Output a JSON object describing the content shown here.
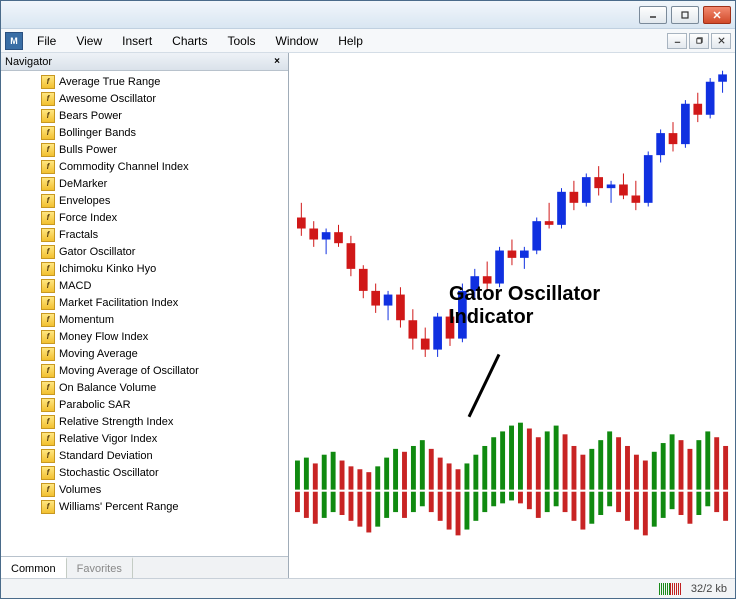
{
  "menu": {
    "items": [
      "File",
      "View",
      "Insert",
      "Charts",
      "Tools",
      "Window",
      "Help"
    ]
  },
  "navigator": {
    "title": "Navigator",
    "tabs": [
      "Common",
      "Favorites"
    ],
    "active_tab": 0,
    "indicators": [
      "Average True Range",
      "Awesome Oscillator",
      "Bears Power",
      "Bollinger Bands",
      "Bulls Power",
      "Commodity Channel Index",
      "DeMarker",
      "Envelopes",
      "Force Index",
      "Fractals",
      "Gator Oscillator",
      "Ichimoku Kinko Hyo",
      "MACD",
      "Market Facilitation Index",
      "Momentum",
      "Money Flow Index",
      "Moving Average",
      "Moving Average of Oscillator",
      "On Balance Volume",
      "Parabolic SAR",
      "Relative Strength Index",
      "Relative Vigor Index",
      "Standard Deviation",
      "Stochastic Oscillator",
      "Volumes",
      "Williams' Percent Range"
    ]
  },
  "annotation": {
    "line1": "Gator Oscillator",
    "line2": "Indicator"
  },
  "status": {
    "conn": "32/2 kb"
  },
  "colors": {
    "bull": "#1030e0",
    "bear": "#d01818",
    "gator_green": "#108a10",
    "gator_red": "#c82424"
  },
  "chart_data": {
    "type": "candlestick+oscillator",
    "candles_note": "o/h/l/c estimated from pixels, relative price units",
    "candles": [
      {
        "o": 58,
        "h": 62,
        "l": 53,
        "c": 55,
        "dir": "bear"
      },
      {
        "o": 55,
        "h": 57,
        "l": 50,
        "c": 52,
        "dir": "bear"
      },
      {
        "o": 52,
        "h": 55,
        "l": 48,
        "c": 54,
        "dir": "bull"
      },
      {
        "o": 54,
        "h": 56,
        "l": 50,
        "c": 51,
        "dir": "bear"
      },
      {
        "o": 51,
        "h": 53,
        "l": 42,
        "c": 44,
        "dir": "bear"
      },
      {
        "o": 44,
        "h": 45,
        "l": 36,
        "c": 38,
        "dir": "bear"
      },
      {
        "o": 38,
        "h": 40,
        "l": 32,
        "c": 34,
        "dir": "bear"
      },
      {
        "o": 34,
        "h": 38,
        "l": 30,
        "c": 37,
        "dir": "bull"
      },
      {
        "o": 37,
        "h": 39,
        "l": 28,
        "c": 30,
        "dir": "bear"
      },
      {
        "o": 30,
        "h": 33,
        "l": 22,
        "c": 25,
        "dir": "bear"
      },
      {
        "o": 25,
        "h": 28,
        "l": 20,
        "c": 22,
        "dir": "bear"
      },
      {
        "o": 22,
        "h": 32,
        "l": 20,
        "c": 31,
        "dir": "bull"
      },
      {
        "o": 31,
        "h": 33,
        "l": 23,
        "c": 25,
        "dir": "bear"
      },
      {
        "o": 25,
        "h": 40,
        "l": 24,
        "c": 38,
        "dir": "bull"
      },
      {
        "o": 38,
        "h": 44,
        "l": 36,
        "c": 42,
        "dir": "bull"
      },
      {
        "o": 42,
        "h": 46,
        "l": 38,
        "c": 40,
        "dir": "bear"
      },
      {
        "o": 40,
        "h": 50,
        "l": 39,
        "c": 49,
        "dir": "bull"
      },
      {
        "o": 49,
        "h": 52,
        "l": 45,
        "c": 47,
        "dir": "bear"
      },
      {
        "o": 47,
        "h": 50,
        "l": 44,
        "c": 49,
        "dir": "bull"
      },
      {
        "o": 49,
        "h": 58,
        "l": 48,
        "c": 57,
        "dir": "bull"
      },
      {
        "o": 57,
        "h": 62,
        "l": 55,
        "c": 56,
        "dir": "bear"
      },
      {
        "o": 56,
        "h": 66,
        "l": 55,
        "c": 65,
        "dir": "bull"
      },
      {
        "o": 65,
        "h": 68,
        "l": 60,
        "c": 62,
        "dir": "bear"
      },
      {
        "o": 62,
        "h": 70,
        "l": 61,
        "c": 69,
        "dir": "bull"
      },
      {
        "o": 69,
        "h": 72,
        "l": 64,
        "c": 66,
        "dir": "bear"
      },
      {
        "o": 66,
        "h": 68,
        "l": 62,
        "c": 67,
        "dir": "bull"
      },
      {
        "o": 67,
        "h": 70,
        "l": 63,
        "c": 64,
        "dir": "bear"
      },
      {
        "o": 64,
        "h": 68,
        "l": 60,
        "c": 62,
        "dir": "bear"
      },
      {
        "o": 62,
        "h": 76,
        "l": 61,
        "c": 75,
        "dir": "bull"
      },
      {
        "o": 75,
        "h": 82,
        "l": 73,
        "c": 81,
        "dir": "bull"
      },
      {
        "o": 81,
        "h": 84,
        "l": 76,
        "c": 78,
        "dir": "bear"
      },
      {
        "o": 78,
        "h": 90,
        "l": 77,
        "c": 89,
        "dir": "bull"
      },
      {
        "o": 89,
        "h": 92,
        "l": 84,
        "c": 86,
        "dir": "bear"
      },
      {
        "o": 86,
        "h": 96,
        "l": 85,
        "c": 95,
        "dir": "bull"
      },
      {
        "o": 95,
        "h": 98,
        "l": 92,
        "c": 97,
        "dir": "bull"
      }
    ],
    "gator": {
      "note": "upper & lower histogram values (relative units) and color",
      "upper": [
        {
          "v": 20,
          "c": "g"
        },
        {
          "v": 22,
          "c": "g"
        },
        {
          "v": 18,
          "c": "r"
        },
        {
          "v": 24,
          "c": "g"
        },
        {
          "v": 26,
          "c": "g"
        },
        {
          "v": 20,
          "c": "r"
        },
        {
          "v": 16,
          "c": "r"
        },
        {
          "v": 14,
          "c": "r"
        },
        {
          "v": 12,
          "c": "r"
        },
        {
          "v": 16,
          "c": "g"
        },
        {
          "v": 22,
          "c": "g"
        },
        {
          "v": 28,
          "c": "g"
        },
        {
          "v": 26,
          "c": "r"
        },
        {
          "v": 30,
          "c": "g"
        },
        {
          "v": 34,
          "c": "g"
        },
        {
          "v": 28,
          "c": "r"
        },
        {
          "v": 22,
          "c": "r"
        },
        {
          "v": 18,
          "c": "r"
        },
        {
          "v": 14,
          "c": "r"
        },
        {
          "v": 18,
          "c": "g"
        },
        {
          "v": 24,
          "c": "g"
        },
        {
          "v": 30,
          "c": "g"
        },
        {
          "v": 36,
          "c": "g"
        },
        {
          "v": 40,
          "c": "g"
        },
        {
          "v": 44,
          "c": "g"
        },
        {
          "v": 46,
          "c": "g"
        },
        {
          "v": 42,
          "c": "r"
        },
        {
          "v": 36,
          "c": "r"
        },
        {
          "v": 40,
          "c": "g"
        },
        {
          "v": 44,
          "c": "g"
        },
        {
          "v": 38,
          "c": "r"
        },
        {
          "v": 30,
          "c": "r"
        },
        {
          "v": 24,
          "c": "r"
        },
        {
          "v": 28,
          "c": "g"
        },
        {
          "v": 34,
          "c": "g"
        },
        {
          "v": 40,
          "c": "g"
        },
        {
          "v": 36,
          "c": "r"
        },
        {
          "v": 30,
          "c": "r"
        },
        {
          "v": 24,
          "c": "r"
        },
        {
          "v": 20,
          "c": "r"
        },
        {
          "v": 26,
          "c": "g"
        },
        {
          "v": 32,
          "c": "g"
        },
        {
          "v": 38,
          "c": "g"
        },
        {
          "v": 34,
          "c": "r"
        },
        {
          "v": 28,
          "c": "r"
        },
        {
          "v": 34,
          "c": "g"
        },
        {
          "v": 40,
          "c": "g"
        },
        {
          "v": 36,
          "c": "r"
        },
        {
          "v": 30,
          "c": "r"
        }
      ],
      "lower": [
        {
          "v": 14,
          "c": "r"
        },
        {
          "v": 18,
          "c": "r"
        },
        {
          "v": 22,
          "c": "r"
        },
        {
          "v": 18,
          "c": "g"
        },
        {
          "v": 14,
          "c": "g"
        },
        {
          "v": 16,
          "c": "r"
        },
        {
          "v": 20,
          "c": "r"
        },
        {
          "v": 24,
          "c": "r"
        },
        {
          "v": 28,
          "c": "r"
        },
        {
          "v": 24,
          "c": "g"
        },
        {
          "v": 18,
          "c": "g"
        },
        {
          "v": 14,
          "c": "g"
        },
        {
          "v": 18,
          "c": "r"
        },
        {
          "v": 14,
          "c": "g"
        },
        {
          "v": 10,
          "c": "g"
        },
        {
          "v": 14,
          "c": "r"
        },
        {
          "v": 20,
          "c": "r"
        },
        {
          "v": 26,
          "c": "r"
        },
        {
          "v": 30,
          "c": "r"
        },
        {
          "v": 26,
          "c": "g"
        },
        {
          "v": 20,
          "c": "g"
        },
        {
          "v": 14,
          "c": "g"
        },
        {
          "v": 10,
          "c": "g"
        },
        {
          "v": 8,
          "c": "g"
        },
        {
          "v": 6,
          "c": "g"
        },
        {
          "v": 8,
          "c": "r"
        },
        {
          "v": 12,
          "c": "r"
        },
        {
          "v": 18,
          "c": "r"
        },
        {
          "v": 14,
          "c": "g"
        },
        {
          "v": 10,
          "c": "g"
        },
        {
          "v": 14,
          "c": "r"
        },
        {
          "v": 20,
          "c": "r"
        },
        {
          "v": 26,
          "c": "r"
        },
        {
          "v": 22,
          "c": "g"
        },
        {
          "v": 16,
          "c": "g"
        },
        {
          "v": 10,
          "c": "g"
        },
        {
          "v": 14,
          "c": "r"
        },
        {
          "v": 20,
          "c": "r"
        },
        {
          "v": 26,
          "c": "r"
        },
        {
          "v": 30,
          "c": "r"
        },
        {
          "v": 24,
          "c": "g"
        },
        {
          "v": 18,
          "c": "g"
        },
        {
          "v": 12,
          "c": "g"
        },
        {
          "v": 16,
          "c": "r"
        },
        {
          "v": 22,
          "c": "r"
        },
        {
          "v": 16,
          "c": "g"
        },
        {
          "v": 10,
          "c": "g"
        },
        {
          "v": 14,
          "c": "r"
        },
        {
          "v": 20,
          "c": "r"
        }
      ]
    }
  }
}
